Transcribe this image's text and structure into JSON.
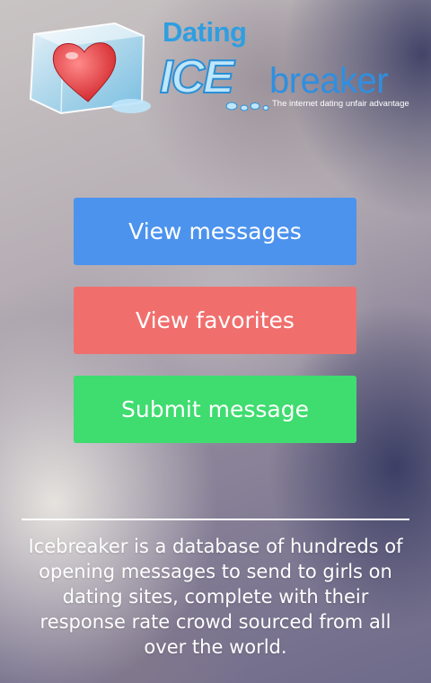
{
  "logo": {
    "word_top": "Dating",
    "word_ice": "ICE",
    "word_breaker": "breaker",
    "tagline": "The internet dating unfair advantage",
    "icons": [
      "ice-cube-icon",
      "heart-icon"
    ],
    "colors": {
      "brand_blue": "#2f9ee0",
      "heart_red": "#e23b3b"
    }
  },
  "buttons": {
    "view_messages": {
      "label": "View messages",
      "color": "#4c93ee"
    },
    "view_favorites": {
      "label": "View favorites",
      "color": "#f06f6d"
    },
    "submit_message": {
      "label": "Submit message",
      "color": "#3fdc6f"
    }
  },
  "description": "Icebreaker is a database of hundreds of opening messages to send to girls on dating sites, complete with their response rate crowd sourced from all over the world."
}
